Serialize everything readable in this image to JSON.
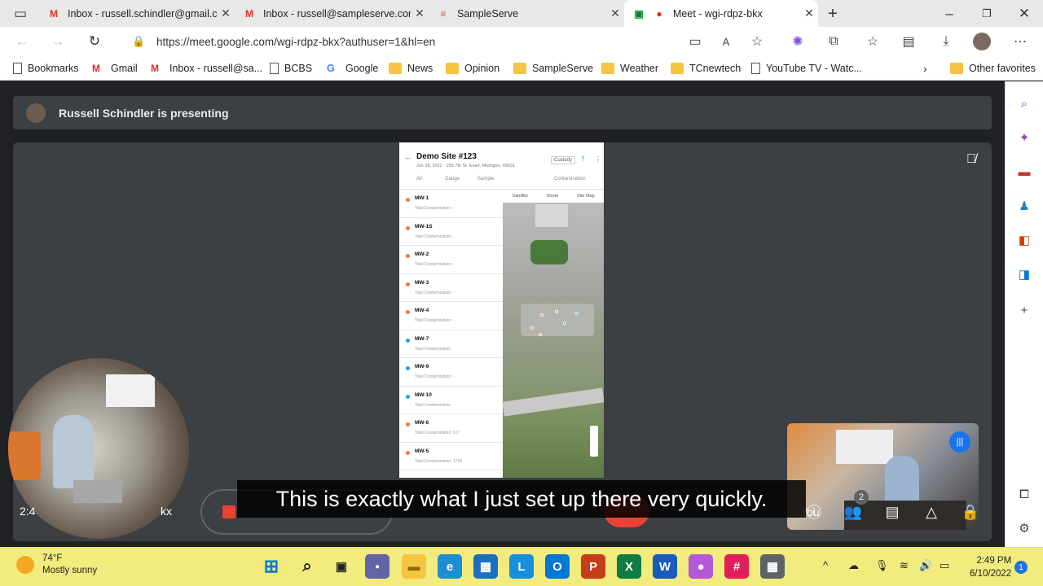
{
  "browser": {
    "tabs": [
      {
        "title": "Inbox - russell.schindler@gmail.c",
        "icon": "gmail-icon"
      },
      {
        "title": "Inbox - russell@sampleserve.com",
        "icon": "gmail-icon"
      },
      {
        "title": "SampleServe",
        "icon": "sampleserve-icon"
      },
      {
        "title": "Meet - wgi-rdpz-bkx",
        "icon": "meet-icon",
        "active": true
      }
    ],
    "url": "https://meet.google.com/wgi-rdpz-bkx?authuser=1&hl=en",
    "bookmarks": [
      {
        "label": "Bookmarks"
      },
      {
        "label": "Gmail"
      },
      {
        "label": "Inbox - russell@sa..."
      },
      {
        "label": "BCBS"
      },
      {
        "label": "Google"
      },
      {
        "label": "News"
      },
      {
        "label": "Opinion"
      },
      {
        "label": "SampleServe"
      },
      {
        "label": "Weather"
      },
      {
        "label": "TCnewtech"
      },
      {
        "label": "YouTube TV - Watc..."
      }
    ],
    "other_favorites": "Other favorites"
  },
  "meet": {
    "presenting_text": "Russell Schindler is presenting",
    "self_label": "You",
    "time": "2:4",
    "code": "kx",
    "participants_count": "2",
    "caption": "This is exactly what I just set up there very quickly."
  },
  "app": {
    "site_title": "Demo Site #123",
    "site_subtitle": "Jun 28, 2022 · 255 7th St, Evart, Michigan, 49631",
    "custody": "Custody",
    "filters": [
      "All",
      "Gauge",
      "Sample"
    ],
    "contamination": "Contamination",
    "map_tabs": [
      "Satellite",
      "Street",
      "Site Map"
    ],
    "wells": [
      {
        "name": "MW-1",
        "sub": "Total Contamination: -",
        "color": "#f27b35"
      },
      {
        "name": "MW-1S",
        "sub": "Total Contamination: -",
        "color": "#f27b35"
      },
      {
        "name": "MW-2",
        "sub": "Total Contamination: -",
        "color": "#f27b35"
      },
      {
        "name": "MW-3",
        "sub": "Total Contamination: -",
        "color": "#f27b35"
      },
      {
        "name": "MW-4",
        "sub": "Total Contamination: -",
        "color": "#f27b35"
      },
      {
        "name": "MW-7",
        "sub": "Total Contamination",
        "color": "#2b9be6"
      },
      {
        "name": "MW-9",
        "sub": "Total Contamination: -",
        "color": "#2b9be6"
      },
      {
        "name": "MW-10",
        "sub": "Total Contamination",
        "color": "#2b9be6"
      },
      {
        "name": "MW-6",
        "sub": "Total Contamination: 617",
        "color": "#f27b35"
      },
      {
        "name": "MW-5",
        "sub": "Total Contamination: 1790",
        "color": "#f27b35"
      }
    ]
  },
  "taskbar": {
    "weather_temp": "74°F",
    "weather_desc": "Mostly sunny",
    "clock_time": "2:49 PM",
    "clock_date": "6/10/2022",
    "notifications": "1"
  },
  "colors": {
    "meet_bg": "#202124",
    "tile_bg": "#3c4043",
    "end_call": "#ea4335",
    "accent": "#1a73e8",
    "taskbar": "#f2eb7d"
  }
}
